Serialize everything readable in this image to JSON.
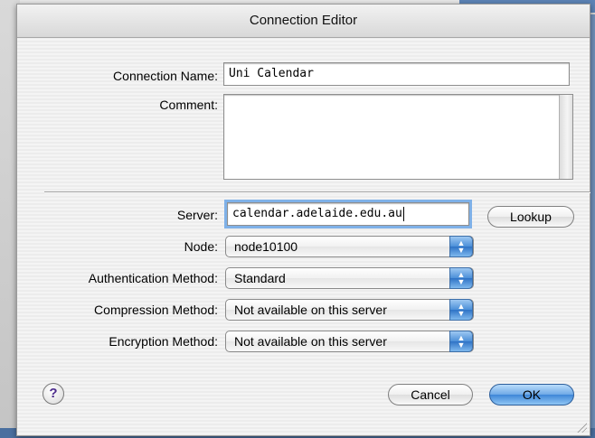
{
  "window": {
    "title": "Connection Editor"
  },
  "form": {
    "connection_name": {
      "label": "Connection Name:",
      "value": "Uni Calendar"
    },
    "comment": {
      "label": "Comment:",
      "value": ""
    },
    "server": {
      "label": "Server:",
      "value": "calendar.adelaide.edu.au"
    },
    "node": {
      "label": "Node:",
      "value": "node10100"
    },
    "authentication_method": {
      "label": "Authentication Method:",
      "value": "Standard"
    },
    "compression_method": {
      "label": "Compression Method:",
      "value": "Not available on this server"
    },
    "encryption_method": {
      "label": "Encryption Method:",
      "value": "Not available on this server"
    }
  },
  "buttons": {
    "lookup": "Lookup",
    "help": "?",
    "cancel": "Cancel",
    "ok": "OK"
  },
  "icons": {
    "help": "question-mark-icon",
    "popup_arrows": "up-down-chevron-icon",
    "resize": "resize-grip-icon"
  },
  "colors": {
    "accent_blue": "#3f86d8",
    "focus_ring": "#7fb1e8"
  }
}
